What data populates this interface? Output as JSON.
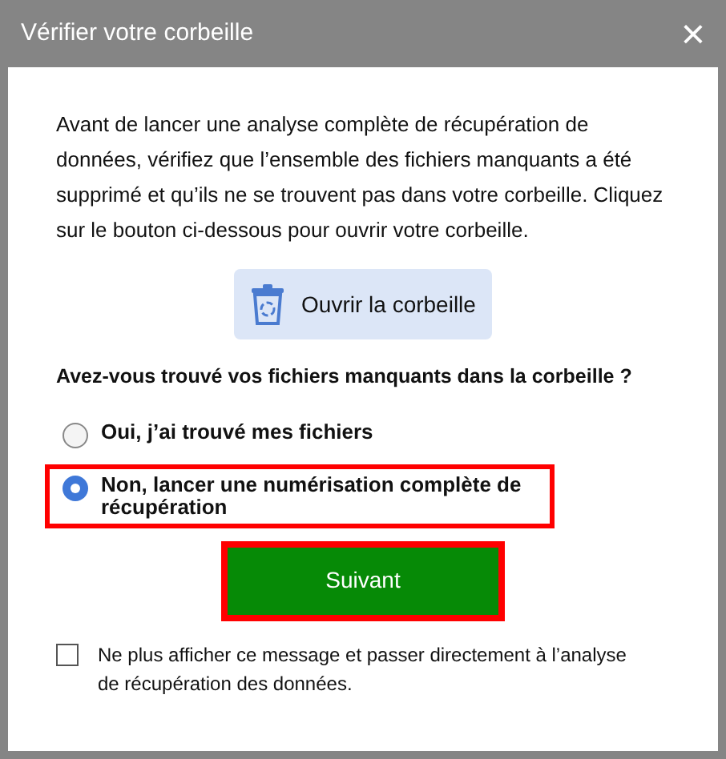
{
  "window": {
    "title": "Vérifier votre corbeille",
    "close": "×"
  },
  "message": "Avant de lancer une analyse complète de récupération de données, vérifiez que l’ensemble des fichiers manquants a été supprimé et qu’ils ne se trouvent pas dans votre corbeille. Cliquez sur le bouton ci-dessous pour ouvrir votre corbeille.",
  "open_button": "Ouvrir la corbeille",
  "question": "Avez-vous trouvé vos fichiers manquants dans la corbeille ?",
  "options": [
    {
      "label": "Oui, j’ai trouvé mes fichiers",
      "selected": false,
      "highlighted": false
    },
    {
      "label": "Non, lancer une numérisation complète de récupération",
      "selected": true,
      "highlighted": true
    }
  ],
  "next_button": {
    "label": "Suivant",
    "highlighted": true
  },
  "dont_show": {
    "label": "Ne plus afficher ce message et passer directement à l’analyse de récupération des données.",
    "checked": false
  }
}
